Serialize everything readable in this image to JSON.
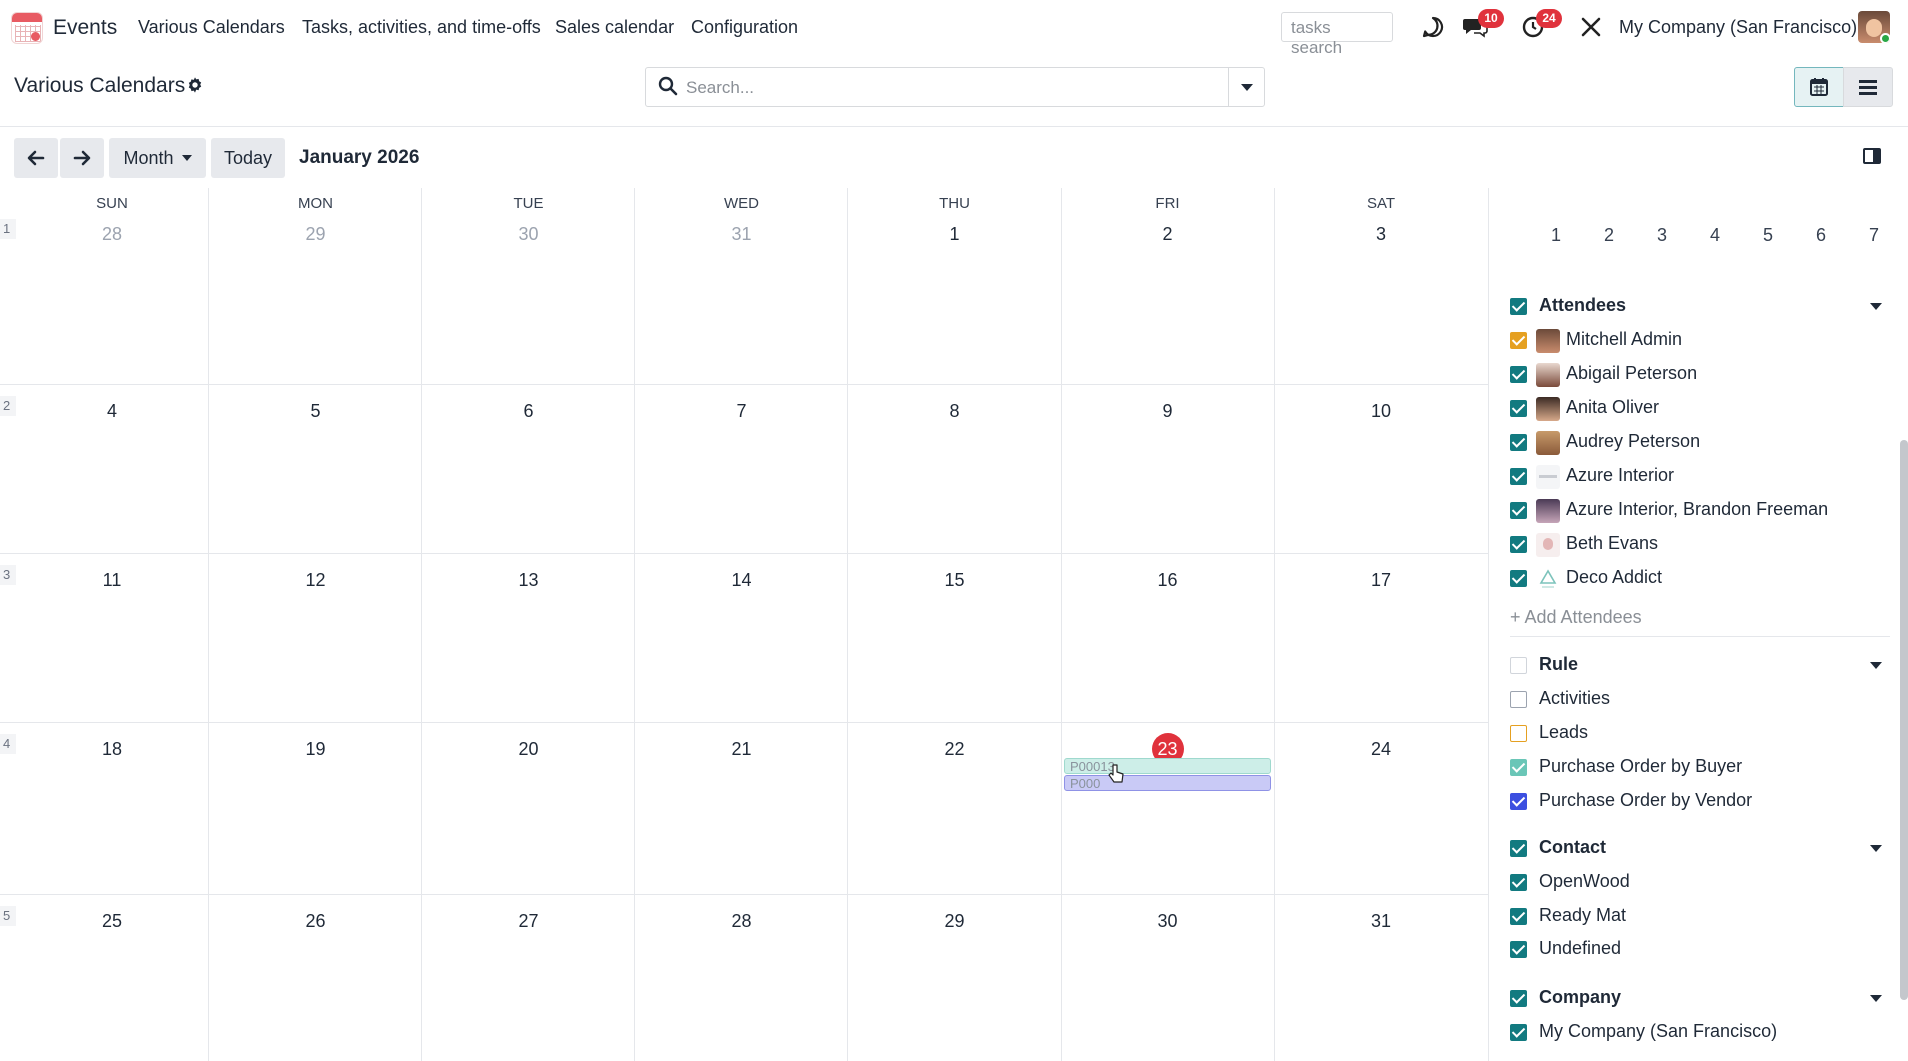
{
  "app": {
    "name": "Events"
  },
  "menu": [
    "Various Calendars",
    "Tasks, activities, and time-offs",
    "Sales calendar",
    "Configuration"
  ],
  "tasks_search": {
    "placeholder": "tasks search"
  },
  "badges": {
    "messages": "10",
    "activities": "24"
  },
  "company": "My Company (San Francisco)",
  "page_title": "Various Calendars",
  "search": {
    "placeholder": "Search..."
  },
  "toolbar": {
    "scale": "Month",
    "today": "Today",
    "period": "January 2026"
  },
  "weekdays": [
    "SUN",
    "MON",
    "TUE",
    "WED",
    "THU",
    "FRI",
    "SAT"
  ],
  "weeks": [
    {
      "number": "1",
      "days": [
        "28",
        "29",
        "30",
        "31",
        "1",
        "2",
        "3"
      ]
    },
    {
      "number": "2",
      "days": [
        "4",
        "5",
        "6",
        "7",
        "8",
        "9",
        "10"
      ]
    },
    {
      "number": "3",
      "days": [
        "11",
        "12",
        "13",
        "14",
        "15",
        "16",
        "17"
      ]
    },
    {
      "number": "4",
      "days": [
        "18",
        "19",
        "20",
        "21",
        "22",
        "23",
        "24"
      ]
    },
    {
      "number": "5",
      "days": [
        "25",
        "26",
        "27",
        "28",
        "29",
        "30",
        "31"
      ]
    }
  ],
  "events": [
    {
      "label": "P00013",
      "color": "#cdeee8"
    },
    {
      "label": "P000",
      "color": "#c9caf6"
    }
  ],
  "mini_days": [
    "1",
    "2",
    "3",
    "4",
    "5",
    "6",
    "7"
  ],
  "filters": {
    "attendees": {
      "title": "Attendees",
      "items": [
        "Mitchell Admin",
        "Abigail Peterson",
        "Anita Oliver",
        "Audrey Peterson",
        "Azure Interior",
        "Azure Interior, Brandon Freeman",
        "Beth Evans",
        "Deco Addict"
      ],
      "add_label": "+ Add Attendees"
    },
    "rule": {
      "title": "Rule",
      "items": [
        "Activities",
        "Leads",
        "Purchase Order by Buyer",
        "Purchase Order by Vendor"
      ]
    },
    "contact": {
      "title": "Contact",
      "items": [
        "OpenWood",
        "Ready Mat",
        "Undefined"
      ]
    },
    "company": {
      "title": "Company",
      "items": [
        "My Company (San Francisco)"
      ]
    }
  },
  "colors": {
    "accent": "#127a80",
    "today": "#e0323c",
    "badge": "#e0323c"
  }
}
